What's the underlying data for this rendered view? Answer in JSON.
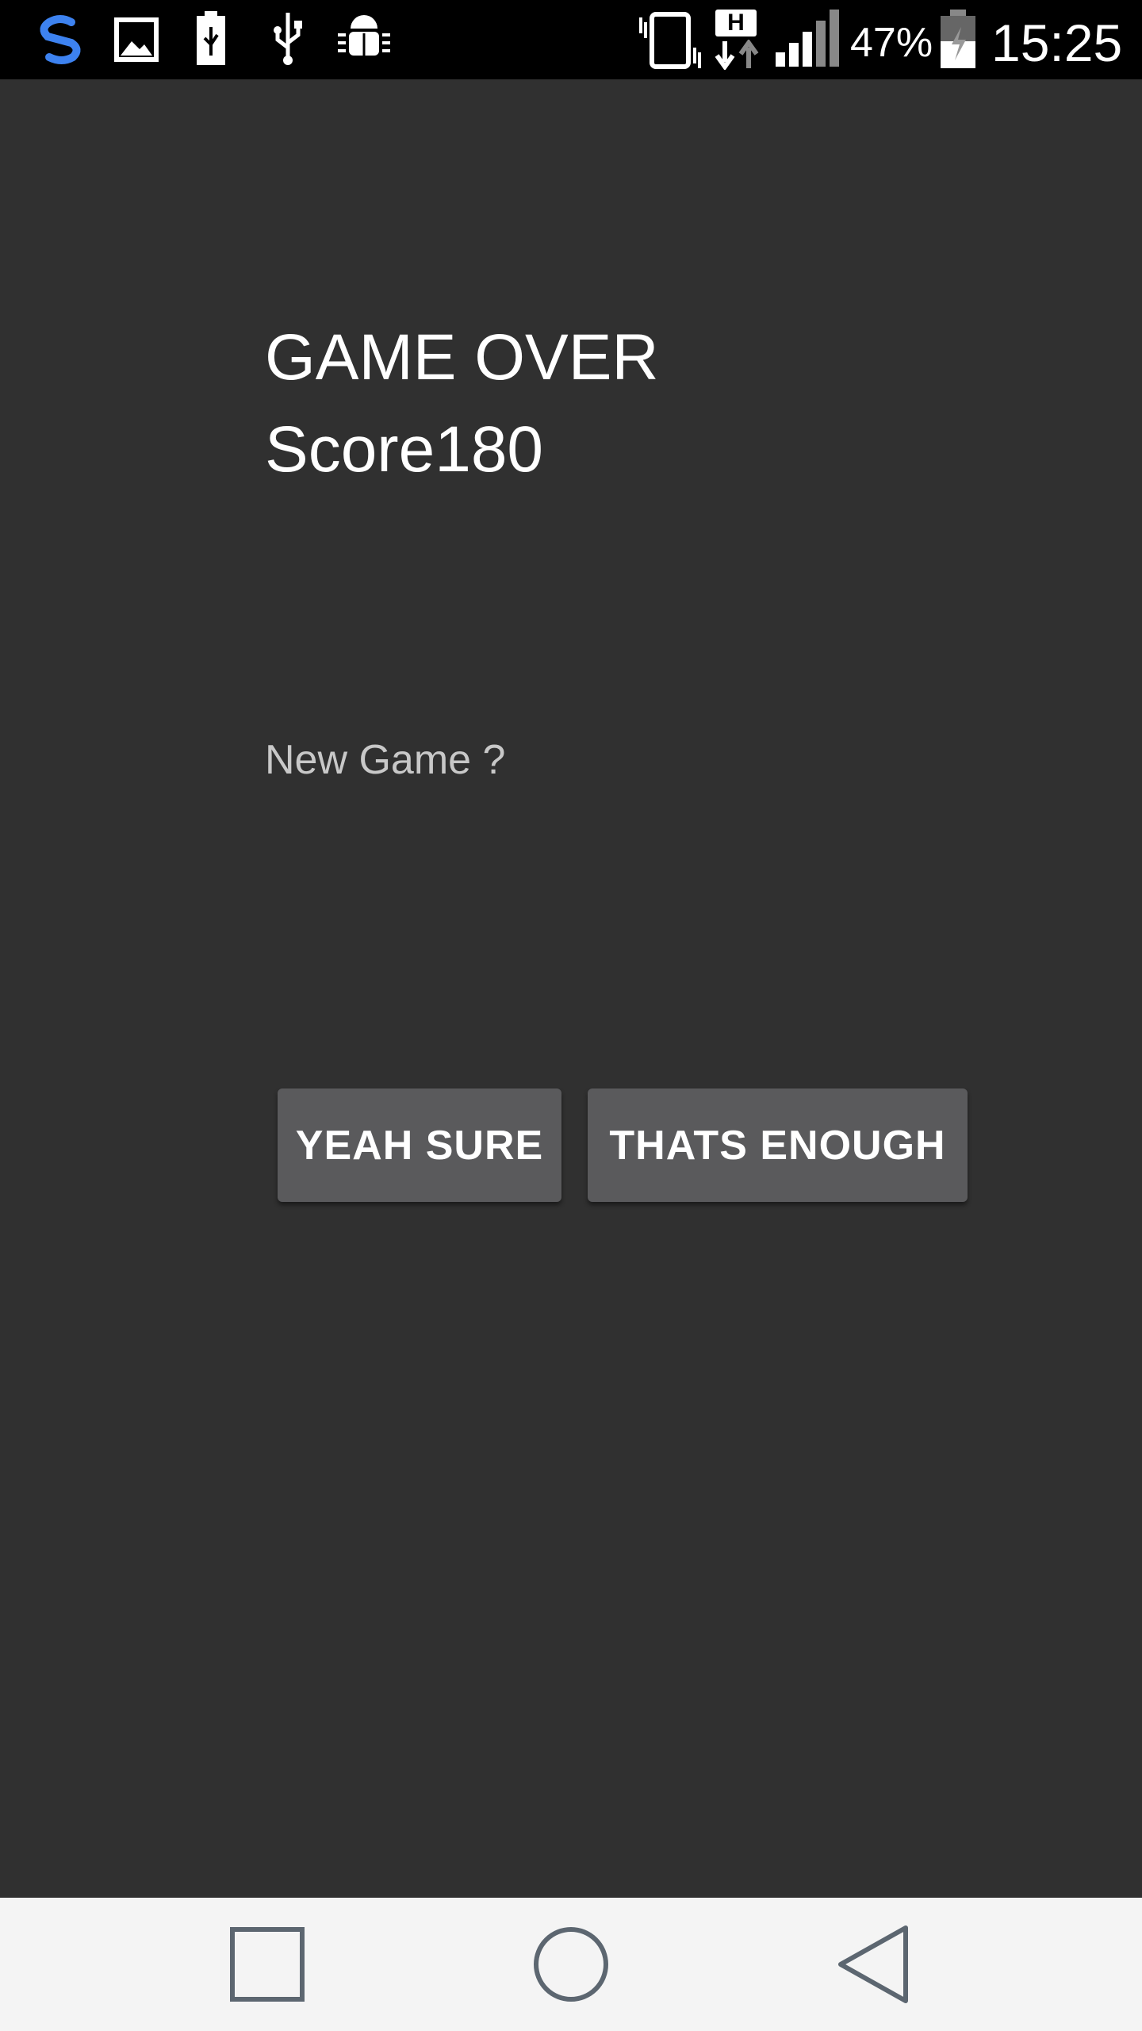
{
  "status_bar": {
    "icons": [
      "skype-icon",
      "image-icon",
      "battery-usb-icon",
      "usb-icon",
      "android-debug-icon",
      "vibrate-icon",
      "h-data-icon",
      "signal-icon",
      "battery-charging-icon"
    ],
    "battery_percent": "47%",
    "time": "15:25",
    "network_type": "H"
  },
  "game": {
    "title": "GAME OVER",
    "score_text": "Score180",
    "prompt": "New Game ?",
    "confirm_label": "YEAH SURE",
    "decline_label": "THATS ENOUGH"
  },
  "nav_bar": {
    "buttons": [
      "recents-icon",
      "home-icon",
      "back-icon"
    ]
  },
  "colors": {
    "background": "#303030",
    "button": "#5a5a5c",
    "status_bar": "#000000",
    "nav_bar": "#f4f4f4",
    "accent_skype": "#3d82f0"
  }
}
